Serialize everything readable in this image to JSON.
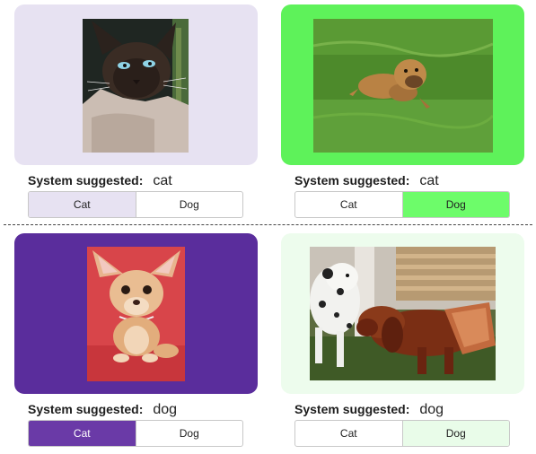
{
  "items": [
    {
      "card_color": "#e7e2f2",
      "photo_subject": "siamese-cat",
      "suggestion_label": "System suggested:",
      "suggestion_value": "cat",
      "selected_option": "Cat",
      "selected_color": "#e7e2f2",
      "selected_text_color": "#222222",
      "options": {
        "cat": "Cat",
        "dog": "Dog"
      }
    },
    {
      "card_color": "#5ef25a",
      "photo_subject": "small-dog-on-grass",
      "suggestion_label": "System suggested:",
      "suggestion_value": "cat",
      "selected_option": "Dog",
      "selected_color": "#6dfc6a",
      "selected_text_color": "#222222",
      "options": {
        "cat": "Cat",
        "dog": "Dog"
      }
    },
    {
      "card_color": "#5a2d9c",
      "photo_subject": "chihuahua",
      "suggestion_label": "System suggested:",
      "suggestion_value": "dog",
      "selected_option": "Cat",
      "selected_color": "#6a3aa7",
      "selected_text_color": "#ffffff",
      "options": {
        "cat": "Cat",
        "dog": "Dog"
      }
    },
    {
      "card_color": "#edfced",
      "photo_subject": "dalmatian-and-setter",
      "suggestion_label": "System suggested:",
      "suggestion_value": "dog",
      "selected_option": "Dog",
      "selected_color": "#e9fce9",
      "selected_text_color": "#222222",
      "options": {
        "cat": "Cat",
        "dog": "Dog"
      }
    }
  ]
}
